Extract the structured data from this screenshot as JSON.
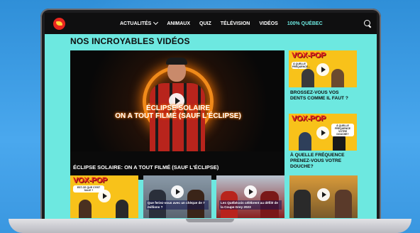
{
  "nav": {
    "items": [
      {
        "label": "ACTUALITÉS",
        "has_dropdown": true,
        "accent": false
      },
      {
        "label": "ANIMAUX",
        "has_dropdown": false,
        "accent": false
      },
      {
        "label": "QUIZ",
        "has_dropdown": false,
        "accent": false
      },
      {
        "label": "TÉLÉVISION",
        "has_dropdown": false,
        "accent": false
      },
      {
        "label": "VIDÉOS",
        "has_dropdown": false,
        "accent": false
      },
      {
        "label": "100% QUÉBEC",
        "has_dropdown": false,
        "accent": true
      }
    ],
    "search_icon": "search-icon",
    "logo_colors": {
      "circle": "#e8261f",
      "mark": "#ffd23a"
    }
  },
  "section": {
    "title": "NOS INCROYABLES VIDÉOS"
  },
  "featured": {
    "overlay_line1": "ÉCLIPSE SOLAIRE",
    "overlay_line2": "ON A TOUT FILMÉ (SAUF L'ÉCLIPSE)",
    "caption": "ÉCLIPSE SOLAIRE: ON A TOUT FILMÉ (SAUF L'ÉCLIPSE)"
  },
  "side_videos": [
    {
      "brand": "VOX-POP",
      "bubble": "À QUELLE FRÉQUENCE...",
      "caption": "BROSSEZ-VOUS VOS DENTS COMME IL FAUT ?"
    },
    {
      "brand": "VOX-POP",
      "bubble": "À QUELLE FRÉQUENCE VOTRE DOUCHE?",
      "caption": "À QUELLE FRÉQUENCE PRENEZ-VOUS VOTRE DOUCHE?"
    }
  ],
  "row_videos": [
    {
      "brand": "VOX-POP",
      "bubble": "EST-CE QUE C'EST SALE ?",
      "caption": ""
    },
    {
      "brand": "",
      "bubble": "",
      "caption": "Que feriez-vous avec un chèque de 7 millions ?"
    },
    {
      "brand": "",
      "bubble": "",
      "caption": "Les Québécois célèbrent au défilé de la Coupe Grey 2023"
    },
    {
      "brand": "",
      "bubble": "",
      "caption": ""
    }
  ],
  "colors": {
    "page_bg": "#6de8e0",
    "navbar": "#0f0f10",
    "vox_yellow": "#f8c21a",
    "vox_red": "#e8261f",
    "accent_cyan": "#6de8e0"
  }
}
